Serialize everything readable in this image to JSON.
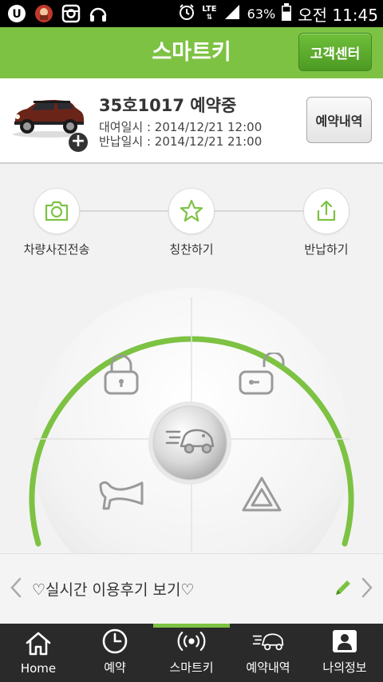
{
  "status_bar": {
    "network": "LTE",
    "battery": "63%",
    "time": "오전 11:45",
    "left_icons": [
      "u-plus-icon",
      "chat-avatar-icon",
      "instagram-icon",
      "headphones-icon"
    ],
    "right_icons": [
      "alarm-icon",
      "lte-icon",
      "signal-icon",
      "battery-icon"
    ]
  },
  "header": {
    "title": "스마트키",
    "cs_button": "고객센터"
  },
  "reservation": {
    "title": "35호1017 예약중",
    "rent_line": "대여일시 : 2014/12/21 12:00",
    "return_line": "반납일시 : 2014/12/21 21:00",
    "history_button": "예약내역"
  },
  "actions": [
    {
      "label": "차량사진전송",
      "icon": "camera-icon"
    },
    {
      "label": "칭찬하기",
      "icon": "star-icon"
    },
    {
      "label": "반납하기",
      "icon": "share-icon"
    }
  ],
  "dial": {
    "lock": "lock-icon",
    "unlock": "unlock-icon",
    "horn": "horn-icon",
    "hazard": "hazard-icon",
    "engine": "car-speed-icon"
  },
  "review": {
    "text": "♡실시간 이용후기 보기♡"
  },
  "nav": [
    {
      "label": "Home",
      "icon": "home-icon",
      "active": false
    },
    {
      "label": "예약",
      "icon": "clock-icon",
      "active": false
    },
    {
      "label": "스마트키",
      "icon": "signal-broadcast-icon",
      "active": true
    },
    {
      "label": "예약내역",
      "icon": "car-speed-icon",
      "active": false
    },
    {
      "label": "나의정보",
      "icon": "profile-icon",
      "active": false
    }
  ],
  "colors": {
    "accent": "#7dc243",
    "nav_bg": "#2a2a2a",
    "status_bg": "#000000"
  }
}
